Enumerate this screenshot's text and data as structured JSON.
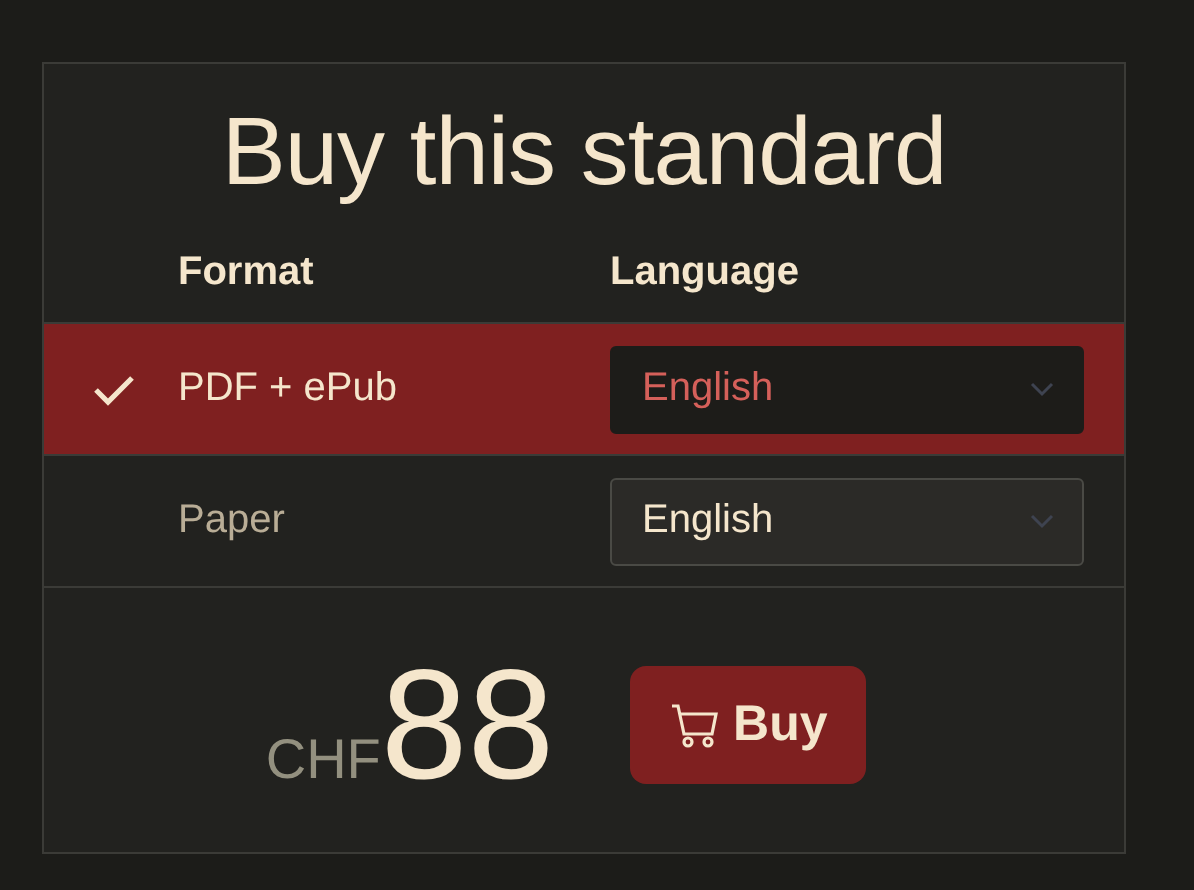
{
  "title": "Buy this standard",
  "columns": [
    "Format",
    "Language"
  ],
  "options": [
    {
      "format": "PDF + ePub",
      "language": "English",
      "selected": true
    },
    {
      "format": "Paper",
      "language": "English",
      "selected": false
    }
  ],
  "price": {
    "currency": "CHF",
    "amount": "88"
  },
  "buy_button": "Buy"
}
